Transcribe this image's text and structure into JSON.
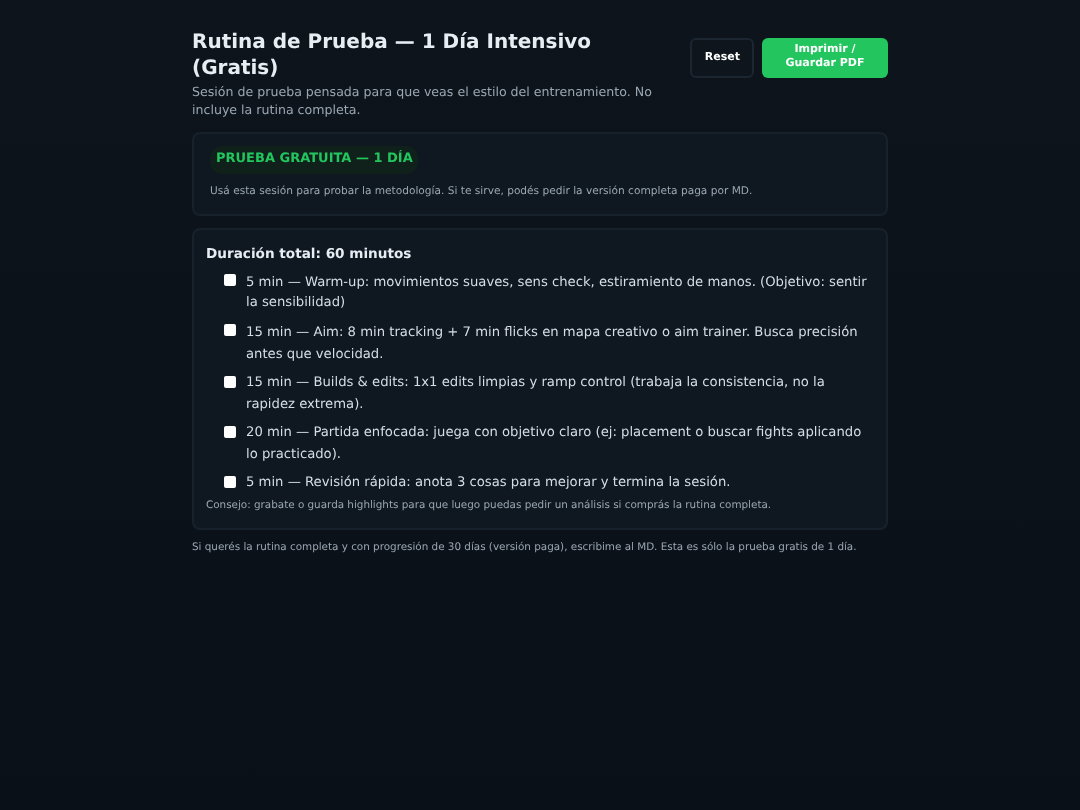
{
  "header": {
    "title": "Rutina de Prueba — 1 Día Intensivo (Gratis)",
    "subtitle": "Sesión de prueba pensada para que veas el estilo del entrenamiento. No incluye la rutina completa.",
    "buttons": [
      {
        "label": "Reset",
        "kind": "secondary"
      },
      {
        "label": "Imprimir / Guardar PDF",
        "kind": "primary"
      }
    ]
  },
  "notice": {
    "badge": "PRUEBA GRATUITA — 1 DÍA",
    "text": "Usá esta sesión para probar la metodología. Si te sirve, podés pedir la versión completa paga por MD."
  },
  "plan": {
    "heading": "Duración total: 60 minutos",
    "tasks": [
      {
        "text": "5 min — Warm-up: movimientos suaves, sens check, estiramiento de manos. (Objetivo: sentir la sensibilidad)",
        "checked": false
      },
      {
        "text": "15 min — Aim: 8 min tracking + 7 min flicks en mapa creativo o aim trainer. Busca precisión antes que velocidad.",
        "checked": false
      },
      {
        "text": "15 min — Builds & edits: 1x1 edits limpias y ramp control (trabaja la consistencia, no la rapidez extrema).",
        "checked": false
      },
      {
        "text": "20 min — Partida enfocada: juega con objetivo claro (ej: placement o buscar fights aplicando lo practicado).",
        "checked": false
      },
      {
        "text": "5 min — Revisión rápida: anota 3 cosas para mejorar y termina la sesión.",
        "checked": false
      }
    ],
    "tip": "Consejo: grabate o guarda highlights para que luego puedas pedir un análisis si comprás la rutina completa."
  },
  "footer": "Si querés la rutina completa y con progresión de 30 días (versión paga), escribime al MD. Esta es sólo la prueba gratis de 1 día."
}
